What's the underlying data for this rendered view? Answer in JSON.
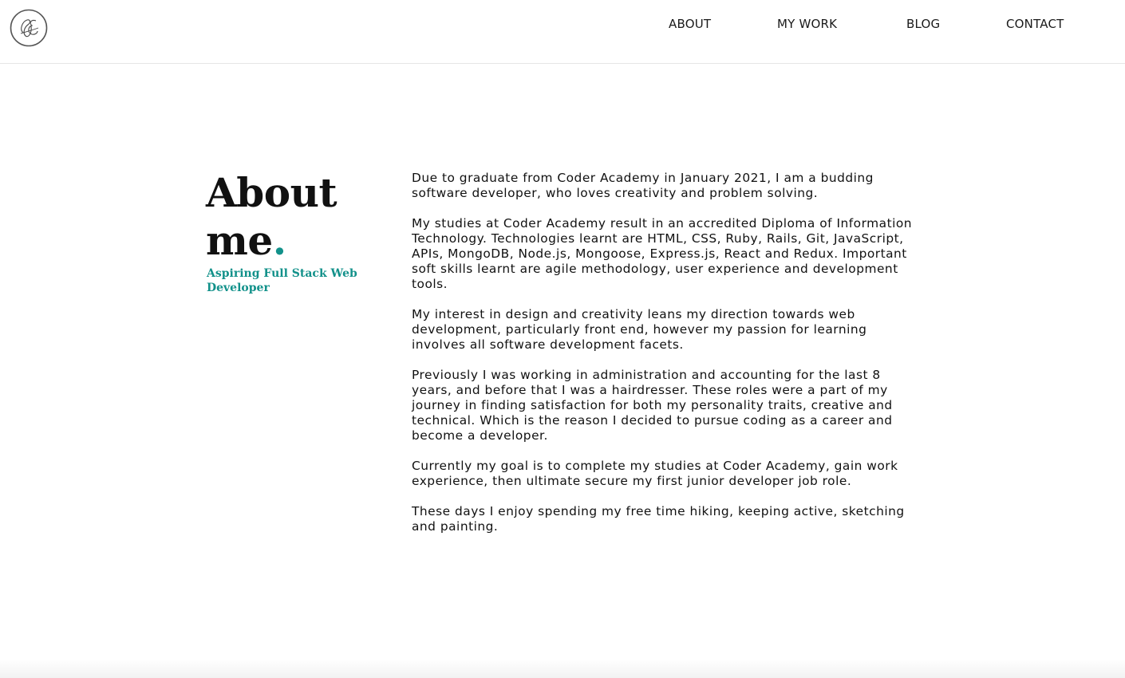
{
  "header": {
    "logo_text": "SE",
    "nav": {
      "about": "ABOUT",
      "my_work": "MY WORK",
      "blog": "BLOG",
      "contact": "CONTACT"
    }
  },
  "main": {
    "title_line1": "About",
    "title_line2": "me",
    "title_dot": ".",
    "subtitle": "Aspiring Full Stack Web Developer",
    "paragraphs": [
      "Due to graduate from Coder Academy in January 2021, I am a budding software developer, who loves creativity and problem solving.",
      "My studies at Coder Academy result in an accredited Diploma of Information Technology. Technologies learnt are HTML, CSS, Ruby, Rails, Git, JavaScript, APIs, MongoDB, Node.js, Mongoose, Express.js, React and Redux. Important soft skills learnt are agile methodology, user experience and development tools.",
      "My interest in design and creativity leans my direction towards web development, particularly front end, however my passion for learning involves all software development facets.",
      "Previously I was working in administration and accounting for the last 8 years, and before that I was a hairdresser. These roles were a part of my journey in finding satisfaction for both my personality traits, creative and technical. Which is the reason I decided to pursue coding as a career and become a developer.",
      "Currently my goal is to complete my studies at Coder Academy, gain work experience, then ultimate secure my first junior developer job role.",
      "These days I enjoy spending my free time hiking, keeping active, sketching and painting."
    ]
  },
  "colors": {
    "accent": "#12918a",
    "text": "#111111",
    "background": "#ffffff"
  }
}
